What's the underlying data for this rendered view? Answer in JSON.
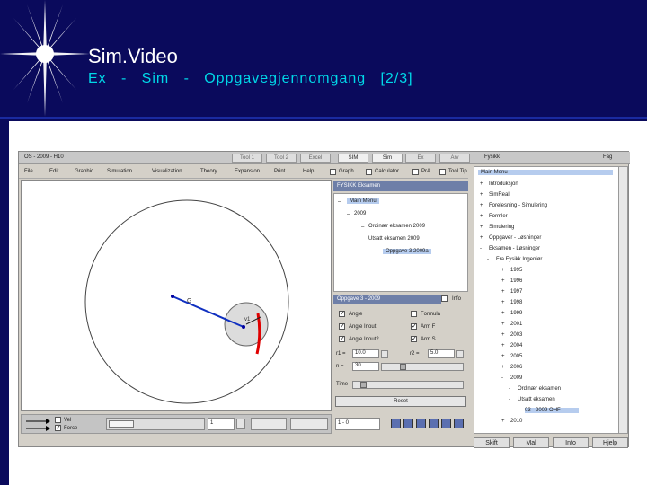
{
  "slide": {
    "title": "Sim.Video",
    "subtitle": "Ex   -   Sim   -   Oppgavegjennomgang   [2/3]"
  },
  "app": {
    "window_title": "OS - 2009 - H10",
    "title_tabs": [
      "Tool 1",
      "Tool 2",
      "Excel",
      "SIM",
      "Sim",
      "Ex",
      "Arv"
    ],
    "right_titlebar": {
      "left": "Fysikk",
      "right": "Fag"
    },
    "menu": [
      "File",
      "Edit",
      "Graphic",
      "Simulation",
      "Visualization",
      "Theory",
      "Expansion",
      "Print",
      "Help"
    ],
    "toggles": [
      "Graph",
      "Calculator",
      "PrA",
      "Tool Tip"
    ],
    "canvas_labels": {
      "g": "G",
      "v": "v1"
    },
    "session_panel": {
      "title": "FYSIKK Eksamen",
      "tree": [
        "Main Menu",
        "2009",
        "Ordinær eksamen 2009",
        "Utsatt eksamen 2009",
        "Oppgave 3 2009a"
      ]
    },
    "task_panel": {
      "title": "Oppgave 3 - 2009",
      "info": "Info",
      "checkboxes": [
        {
          "label": "Angle",
          "checked": true
        },
        {
          "label": "Formula",
          "checked": false
        },
        {
          "label": "Angle Inout",
          "checked": true
        },
        {
          "label": "Arm F",
          "checked": true
        },
        {
          "label": "Angle Inout2",
          "checked": true
        },
        {
          "label": "Arm S",
          "checked": true
        }
      ],
      "fields": [
        {
          "label": "r1 =",
          "value": "10.0"
        },
        {
          "label": "r2 =",
          "value": "5.0"
        },
        {
          "label": "n =",
          "value": "30"
        },
        {
          "label": "Time",
          "value": ""
        }
      ],
      "reset": "Reset"
    },
    "bottom_bar": {
      "legend": [
        "Vel",
        "Force"
      ],
      "step_value": "1",
      "counter": "1 - 0"
    },
    "main_menu": {
      "title": "Main Menu",
      "items": [
        {
          "sign": "+",
          "label": "Introduksjon"
        },
        {
          "sign": "+",
          "label": "SimReal"
        },
        {
          "sign": "+",
          "label": "Forelesning - Simulering"
        },
        {
          "sign": "+",
          "label": "Formler"
        },
        {
          "sign": "+",
          "label": "Simulering"
        },
        {
          "sign": "+",
          "label": "Oppgaver - Løsninger"
        },
        {
          "sign": "-",
          "label": "Eksamen - Løsninger"
        },
        {
          "sign": "-",
          "label": "Fra Fysikk Ingeniør"
        },
        {
          "sign": "+",
          "label": "1995"
        },
        {
          "sign": "+",
          "label": "1996"
        },
        {
          "sign": "+",
          "label": "1997"
        },
        {
          "sign": "+",
          "label": "1998"
        },
        {
          "sign": "+",
          "label": "1999"
        },
        {
          "sign": "+",
          "label": "2001"
        },
        {
          "sign": "+",
          "label": "2003"
        },
        {
          "sign": "+",
          "label": "2004"
        },
        {
          "sign": "+",
          "label": "2005"
        },
        {
          "sign": "+",
          "label": "2006"
        },
        {
          "sign": "-",
          "label": "2009"
        },
        {
          "sign": "-",
          "label": "Ordinær eksamen"
        },
        {
          "sign": "-",
          "label": "Utsatt eksamen"
        },
        {
          "sign": "-",
          "label": "03 - 2009 OHF"
        },
        {
          "sign": "+",
          "label": "2010"
        }
      ],
      "buttons": [
        "Skift",
        "Mal",
        "Info",
        "Hjelp"
      ]
    }
  }
}
